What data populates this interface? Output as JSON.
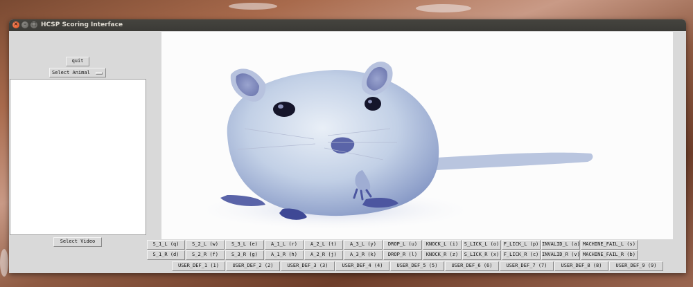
{
  "window": {
    "title": "HCSP Scoring Interface",
    "controls": {
      "close": "×",
      "minimize": "–",
      "maximize": "□"
    }
  },
  "left_panel": {
    "quit_label": "quit",
    "animal_select": {
      "selected": "Select Animal"
    },
    "select_video_label": "Select Video"
  },
  "scoring_buttons": {
    "row1": [
      "S_1_L (q)",
      "S_2_L (w)",
      "S_3_L (e)",
      "A_1_L (r)",
      "A_2_L (t)",
      "A_3_L (y)",
      "DROP_L (u)",
      "KNOCK_L (i)",
      "S_LICK_L (o)",
      "F_LICK_L (p)",
      "INVALID_L (a)",
      "MACHINE_FAIL_L (s)"
    ],
    "row2": [
      "S_1_R (d)",
      "S_2_R (f)",
      "S_3_R (g)",
      "A_1_R (h)",
      "A_2_R (j)",
      "A_3_R (k)",
      "DROP_R (l)",
      "KNOCK_R (z)",
      "S_LICK_R (x)",
      "F_LICK_R (c)",
      "INVALID_R (v)",
      "MACHINE_FAIL_R (b)"
    ],
    "row3": [
      "USER_DEF_1 (1)",
      "USER_DEF_2 (2)",
      "USER_DEF_3 (3)",
      "USER_DEF_4 (4)",
      "USER_DEF_5 (5)",
      "USER_DEF_6 (6)",
      "USER_DEF_7 (7)",
      "USER_DEF_8 (8)",
      "USER_DEF_9 (9)"
    ]
  },
  "colors": {
    "titlebar": "#3b3a36",
    "window_bg": "#d9d9d9",
    "close_button": "#df4b16"
  }
}
